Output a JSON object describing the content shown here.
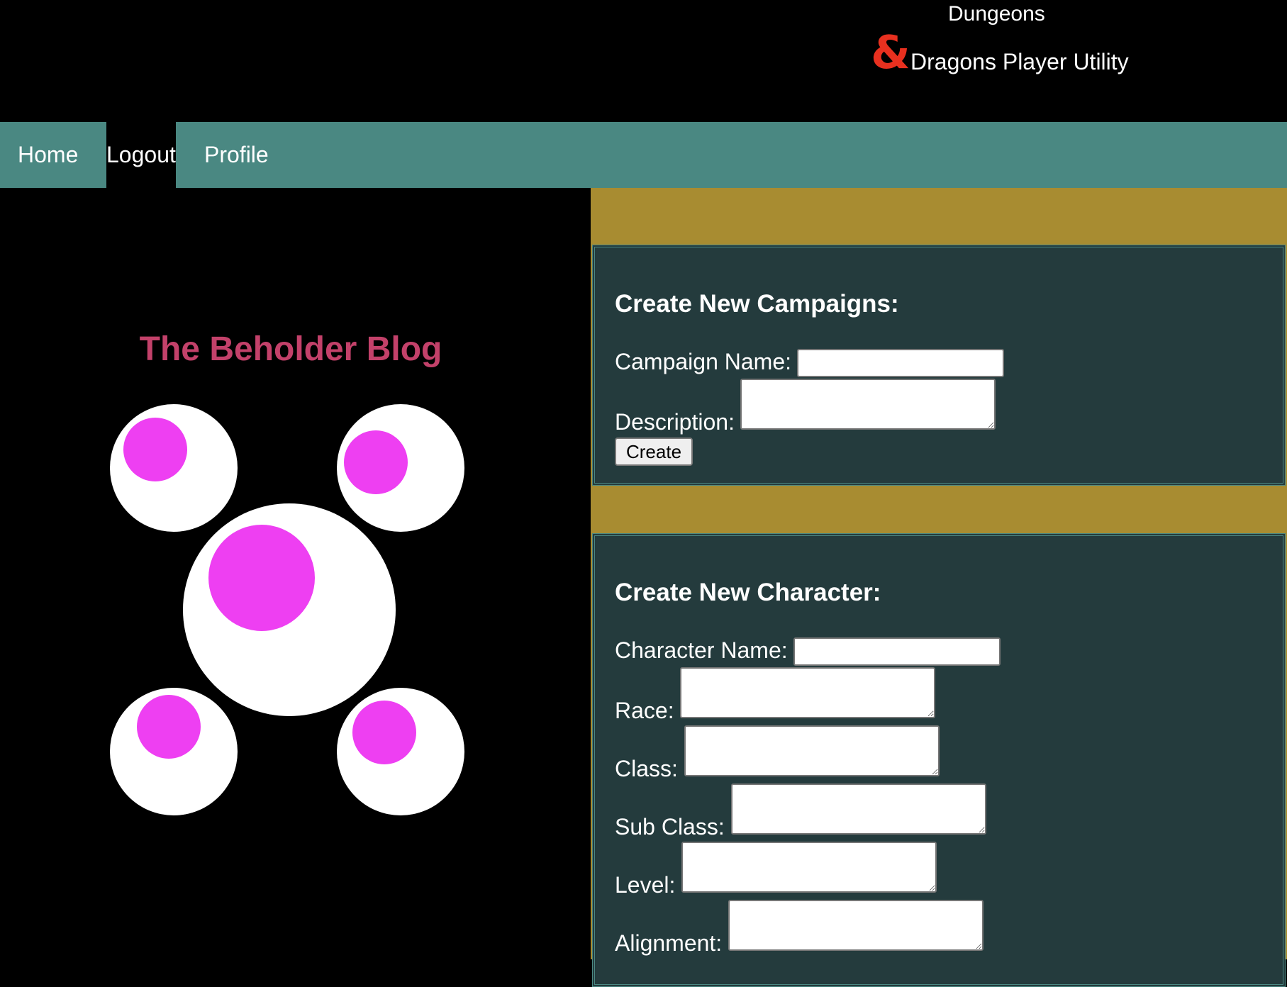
{
  "header": {
    "title_line1": "Dungeons",
    "ampersand": "&",
    "title_line2": "Dragons Player Utility"
  },
  "nav": {
    "home": "Home",
    "logout": "Logout",
    "profile": "Profile"
  },
  "left": {
    "blog_title": "The Beholder Blog",
    "logo": "beholder-eyes-logo"
  },
  "campaign_form": {
    "heading": "Create New Campaigns:",
    "name_label": "Campaign Name:",
    "name_value": "",
    "description_label": "Description:",
    "description_value": "",
    "submit_label": "Create"
  },
  "character_form": {
    "heading": "Create New Character:",
    "name_label": "Character Name:",
    "race_label": "Race:",
    "class_label": "Class:",
    "subclass_label": "Sub Class:",
    "level_label": "Level:",
    "alignment_label": "Alignment:"
  },
  "colors": {
    "accent_teal": "#4a8882",
    "accent_gold": "#a88c31",
    "card_bg": "#243b3d",
    "blog_title": "#c3416a",
    "ampersand": "#e8301f",
    "iris": "#ee3ff2"
  }
}
